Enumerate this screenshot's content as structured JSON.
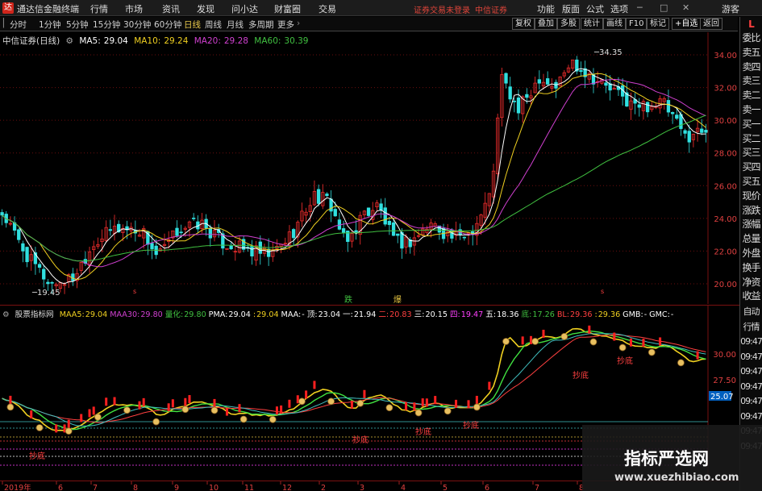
{
  "titlebar": {
    "app_title": "通达信金融终端",
    "menus": [
      "行情",
      "市场",
      "资讯",
      "发现",
      "问小达",
      "财富圈",
      "交易"
    ],
    "notice_login": "证券交易未登录",
    "notice_broker": "中信证券",
    "right_menus": [
      "功能",
      "版面",
      "公式",
      "选项"
    ],
    "guest": "游客"
  },
  "toolbar": {
    "periods": [
      "分时",
      "1分钟",
      "5分钟",
      "15分钟",
      "30分钟",
      "60分钟",
      "日线",
      "周线",
      "月线",
      "多周期",
      "更多"
    ],
    "active_period": "日线",
    "buttons": [
      "复权",
      "叠加",
      "多股",
      "统计",
      "画线",
      "F10",
      "标记"
    ],
    "add_watchlist": "+自选",
    "back": "返回"
  },
  "main_chart": {
    "stock_title": "中信证券(日线)",
    "ma_legend": [
      {
        "label": "MA5:",
        "value": "29.04",
        "color": "#ffffff"
      },
      {
        "label": "MA10:",
        "value": "29.24",
        "color": "#f0d020"
      },
      {
        "label": "MA20:",
        "value": "29.28",
        "color": "#d040d0"
      },
      {
        "label": "MA60:",
        "value": "30.39",
        "color": "#40c040"
      }
    ],
    "price_ticks": [
      "34.00",
      "32.00",
      "30.00",
      "28.00",
      "26.00",
      "24.00",
      "22.00",
      "20.00"
    ],
    "high_label": "34.35",
    "low_label": "19.45",
    "label_die": "跌",
    "label_bao": "爆",
    "label_s": "s"
  },
  "indicator": {
    "name": "股票指标网",
    "legend": [
      {
        "label": "MAA5:",
        "value": "29.04",
        "color": "#f0d020"
      },
      {
        "label": "MAA30:",
        "value": "29.80",
        "color": "#d040d0"
      },
      {
        "label": "量化:",
        "value": "29.80",
        "color": "#40c040"
      },
      {
        "label": "PMA:",
        "value": "29.04",
        "color": "#ffffff"
      },
      {
        "label": ":",
        "value": "29.04",
        "color": "#f0d020"
      },
      {
        "label": "MAA:",
        "value": "-",
        "color": "#ffffff"
      },
      {
        "label": "顶:",
        "value": "23.04",
        "color": "#ffffff"
      },
      {
        "label": "一:",
        "value": "21.94",
        "color": "#ffffff"
      },
      {
        "label": "二:",
        "value": "20.83",
        "color": "#ff4040"
      },
      {
        "label": "三:",
        "value": "20.15",
        "color": "#ffffff"
      },
      {
        "label": "四:",
        "value": "19.47",
        "color": "#ff40ff"
      },
      {
        "label": "五:",
        "value": "18.36",
        "color": "#ffffff"
      },
      {
        "label": "底:",
        "value": "17.26",
        "color": "#40c040"
      },
      {
        "label": "BL:",
        "value": "29.36",
        "color": "#ff4040"
      },
      {
        "label": ":",
        "value": "29.36",
        "color": "#f0d020"
      },
      {
        "label": "GMB:",
        "value": "-",
        "color": "#ffffff"
      },
      {
        "label": "GMC:",
        "value": "-",
        "color": "#ffffff"
      }
    ],
    "ticks": [
      "30.00",
      "27.50"
    ],
    "current_value": "25.07",
    "bottom_signal": "抄底"
  },
  "right_panel_top": [
    "委比",
    "卖五",
    "卖四",
    "卖三",
    "卖二",
    "卖一",
    "买一",
    "买二",
    "买三",
    "买四",
    "买五",
    "现价",
    "涨跌",
    "涨幅",
    "总量",
    "外盘",
    "换手",
    "净资",
    "收益"
  ],
  "right_panel_bottom": [
    "自动",
    "行情",
    "09:47",
    "09:47",
    "09:47",
    "09:47",
    "09:47",
    "09:47",
    "09:47",
    "09:47"
  ],
  "right_tab": "L",
  "x_axis": [
    "2019年",
    "6",
    "7",
    "8",
    "9",
    "10",
    "11",
    "12",
    "2",
    "3",
    "4",
    "5",
    "6",
    "7",
    "8"
  ],
  "watermark": {
    "title": "指标严选网",
    "url": "www.xuezhibiao.com"
  },
  "colors": {
    "up": "#ff3030",
    "down": "#30e0e0",
    "ma5": "#ffffff",
    "ma10": "#f0d020",
    "ma20": "#d040d0",
    "ma60": "#40c040",
    "grid": "#6a0e0e"
  }
}
